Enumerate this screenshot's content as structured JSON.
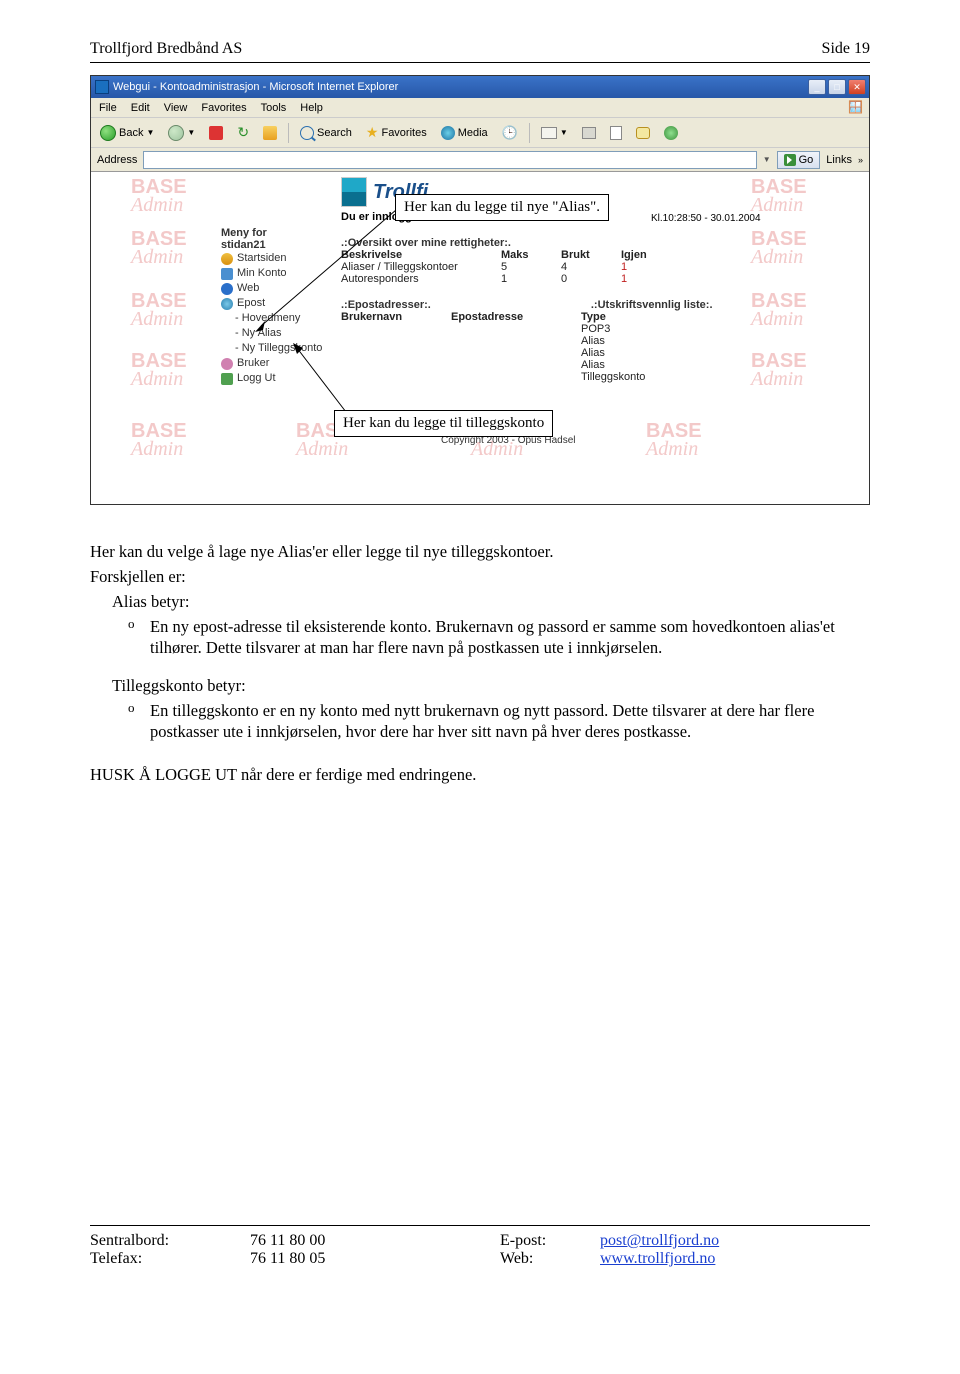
{
  "doc": {
    "header_left": "Trollfjord Bredbånd AS",
    "header_right": "Side 19"
  },
  "ie": {
    "title": "Webgui - Kontoadministrasjon - Microsoft Internet Explorer",
    "menu": [
      "File",
      "Edit",
      "View",
      "Favorites",
      "Tools",
      "Help"
    ],
    "toolbar": {
      "back": "Back",
      "search": "Search",
      "favorites": "Favorites",
      "media": "Media"
    },
    "address_label": "Address",
    "go": "Go",
    "links": "Links"
  },
  "webgui": {
    "logged_in_label": "Du er innlogget som:",
    "timestamp": "Kl.10:28:50 - 30.01.2004",
    "menu_for": "Meny for",
    "username": "stidan21",
    "sidebar": {
      "startsiden": "Startsiden",
      "min_konto": "Min Konto",
      "web": "Web",
      "epost": "Epost",
      "hovedmeny": "- Hovedmeny",
      "ny_alias": "- Ny Alias",
      "ny_tillegg": "- Ny Tilleggskonto",
      "bruker": "Bruker",
      "logg_ut": "Logg Ut"
    },
    "rights_header": ".:Oversikt over mine rettigheter:.",
    "rights_cols": {
      "beskrivelse": "Beskrivelse",
      "maks": "Maks",
      "brukt": "Brukt",
      "igjen": "Igjen"
    },
    "rights_rows": [
      {
        "beskrivelse": "Aliaser / Tilleggskontoer",
        "maks": "5",
        "brukt": "4",
        "igjen": "1"
      },
      {
        "beskrivelse": "Autoresponders",
        "maks": "1",
        "brukt": "0",
        "igjen": "1"
      }
    ],
    "epost_header": ".:Epostadresser:.",
    "utskrift_header": ".:Utskriftsvennlig liste:.",
    "epost_cols": {
      "brukernavn": "Brukernavn",
      "epost": "Epostadresse",
      "type": "Type"
    },
    "epost_types": [
      "POP3",
      "Alias",
      "Alias",
      "Alias",
      "Tilleggskonto"
    ],
    "copyright": "Copyright 2003 - Opus Hadsel",
    "watermark_top": "BASE",
    "watermark_bot": "Admin"
  },
  "callouts": {
    "c1": "Her kan du legge til nye \"Alias\".",
    "c2": "Her kan du legge til tilleggskonto"
  },
  "body": {
    "intro": "Her kan du velge å lage nye Alias'er eller legge til nye tilleggskontoer.",
    "forskjellen": "Forskjellen er:",
    "alias_betyr": "Alias betyr:",
    "alias_bullet": "En ny epost-adresse til eksisterende konto. Brukernavn og passord er samme som hovedkontoen alias'et tilhører. Dette tilsvarer at man har flere navn på postkassen ute i innkjørselen.",
    "tillegg_betyr": "Tilleggskonto betyr:",
    "tillegg_bullet": "En tilleggskonto er en ny konto med nytt brukernavn og nytt passord. Dette tilsvarer at dere har flere postkasser ute i innkjørselen, hvor dere har hver sitt navn på hver deres postkasse.",
    "husk": "HUSK Å LOGGE UT når dere er ferdige med endringene."
  },
  "footer": {
    "sentralbord_label": "Sentralbord:",
    "sentralbord_val": "76 11 80 00",
    "telefax_label": "Telefax:",
    "telefax_val": "76 11 80 05",
    "epost_label": "E-post:",
    "epost_val": "post@trollfjord.no",
    "web_label": "Web:",
    "web_val": "www.trollfjord.no"
  }
}
